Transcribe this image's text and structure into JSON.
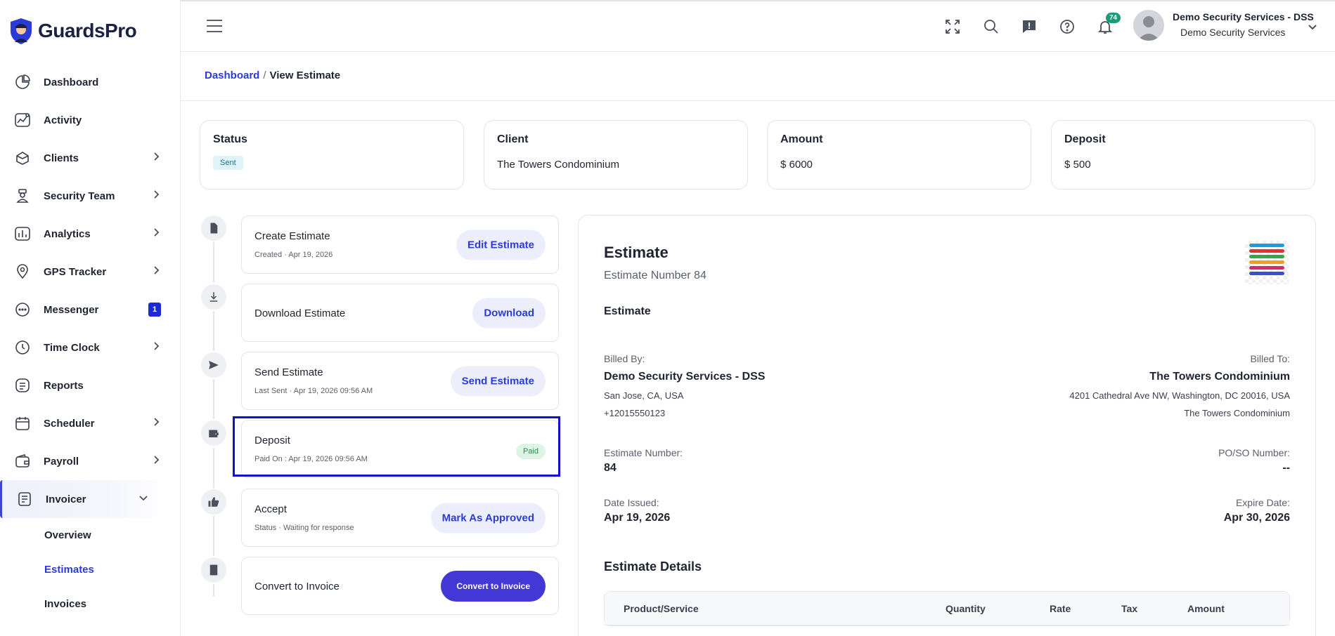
{
  "brand": {
    "name": "GuardsPro"
  },
  "sidebar": {
    "items": [
      {
        "label": "Dashboard",
        "icon": "dashboard-icon",
        "chevron": false
      },
      {
        "label": "Activity",
        "icon": "activity-icon",
        "chevron": false
      },
      {
        "label": "Clients",
        "icon": "clients-icon",
        "chevron": true
      },
      {
        "label": "Security Team",
        "icon": "security-team-icon",
        "chevron": true
      },
      {
        "label": "Analytics",
        "icon": "analytics-icon",
        "chevron": true
      },
      {
        "label": "GPS Tracker",
        "icon": "gps-icon",
        "chevron": true
      },
      {
        "label": "Messenger",
        "icon": "messenger-icon",
        "badge": "1"
      },
      {
        "label": "Time Clock",
        "icon": "clock-icon",
        "chevron": true
      },
      {
        "label": "Reports",
        "icon": "reports-icon",
        "chevron": false
      },
      {
        "label": "Scheduler",
        "icon": "calendar-icon",
        "chevron": true
      },
      {
        "label": "Payroll",
        "icon": "wallet-icon",
        "chevron": true
      },
      {
        "label": "Invoicer",
        "icon": "invoice-icon",
        "expanded": true
      }
    ],
    "subitems": [
      {
        "label": "Overview"
      },
      {
        "label": "Estimates",
        "current": true
      },
      {
        "label": "Invoices"
      }
    ]
  },
  "topbar": {
    "notification_count": "74",
    "user_name": "Demo Security Services - DSS",
    "user_org": "Demo Security Services"
  },
  "breadcrumb": {
    "parent": "Dashboard",
    "separator": "/",
    "current": "View Estimate"
  },
  "summary": {
    "status": {
      "title": "Status",
      "value": "Sent"
    },
    "client": {
      "title": "Client",
      "value": "The Towers Condominium"
    },
    "amount": {
      "title": "Amount",
      "value": "$ 6000"
    },
    "deposit": {
      "title": "Deposit",
      "value": "$ 500"
    }
  },
  "steps": {
    "create": {
      "title": "Create Estimate",
      "sub": "Created · Apr 19, 2026",
      "button": "Edit Estimate"
    },
    "download": {
      "title": "Download Estimate",
      "button": "Download"
    },
    "send": {
      "title": "Send Estimate",
      "sub": "Last Sent · Apr 19, 2026 09:56 AM",
      "button": "Send Estimate"
    },
    "deposit": {
      "title": "Deposit",
      "sub": "Paid On : Apr 19, 2026 09:56 AM",
      "status": "Paid"
    },
    "accept": {
      "title": "Accept",
      "sub": "Status · Waiting for response",
      "button": "Mark As Approved"
    },
    "convert": {
      "title": "Convert to Invoice",
      "button": "Convert to Invoice"
    }
  },
  "estimate": {
    "title": "Estimate",
    "number_line": "Estimate Number 84",
    "subheading": "Estimate",
    "billed_by_label": "Billed By:",
    "billed_by_name": "Demo Security Services - DSS",
    "billed_by_address": "San Jose, CA, USA",
    "billed_by_phone": "+12015550123",
    "billed_to_label": "Billed To:",
    "billed_to_name": "The Towers Condominium",
    "billed_to_address": "4201 Cathedral Ave NW, Washington, DC 20016, USA",
    "billed_to_extra": "The Towers Condominium",
    "estimate_number_label": "Estimate Number:",
    "estimate_number": "84",
    "po_label": "PO/SO Number:",
    "po_value": "--",
    "date_issued_label": "Date Issued:",
    "date_issued": "Apr 19, 2026",
    "expire_label": "Expire Date:",
    "expire_date": "Apr 30, 2026",
    "details_heading": "Estimate Details",
    "columns": [
      "Product/Service",
      "Quantity",
      "Rate",
      "Tax",
      "Amount"
    ],
    "logo_colors": [
      "#1e9be0",
      "#e03232",
      "#3aa64a",
      "#f0a020",
      "#d42a6a",
      "#3a4fd0"
    ]
  },
  "colors": {
    "accent": "#2b3bd8",
    "primary_button": "#4338d6",
    "highlight": "#1212cc"
  }
}
